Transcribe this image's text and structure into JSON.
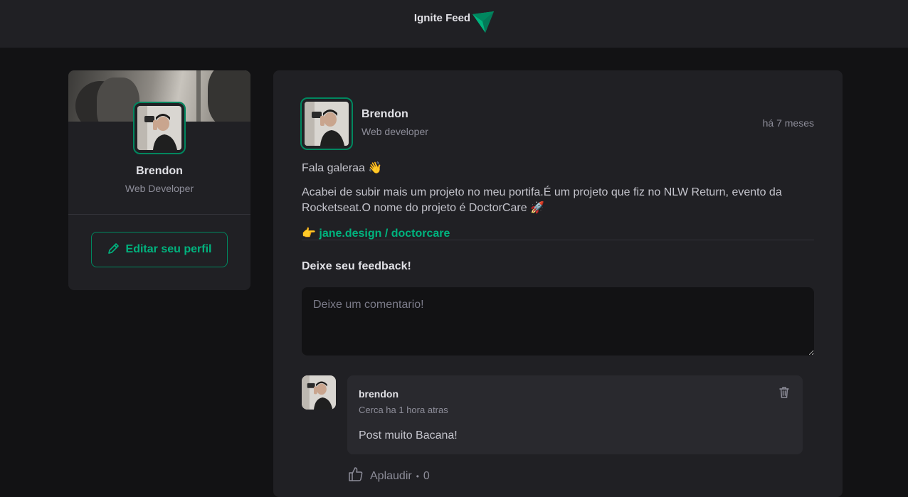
{
  "header": {
    "title": "Ignite Feed",
    "logo_icon": "ignite-logo-icon"
  },
  "sidebar": {
    "name": "Brendon",
    "role": "Web Developer",
    "edit_button": "Editar seu perfil"
  },
  "post": {
    "author_name": "Brendon",
    "author_role": "Web developer",
    "time": "há 7 meses",
    "greeting": "Fala galeraa 👋",
    "body": "Acabei de subir mais um projeto no meu portifa.É um projeto que fiz no NLW Return, evento da Rocketseat.O nome do projeto é DoctorCare 🚀",
    "link_prefix": "👉",
    "link_text": "jane.design / doctorcare",
    "feedback_title": "Deixe seu feedback!",
    "comment_placeholder": "Deixe um comentario!"
  },
  "comment": {
    "author": "brendon",
    "time": "Cerca ha 1 hora atras",
    "text": "Post muito Bacana!",
    "applaud_label": "Aplaudir",
    "applaud_separator": "•",
    "applaud_count": "0"
  },
  "colors": {
    "accent": "#00875f",
    "accent_light": "#00b37e",
    "background": "#121214",
    "card": "#202024"
  }
}
